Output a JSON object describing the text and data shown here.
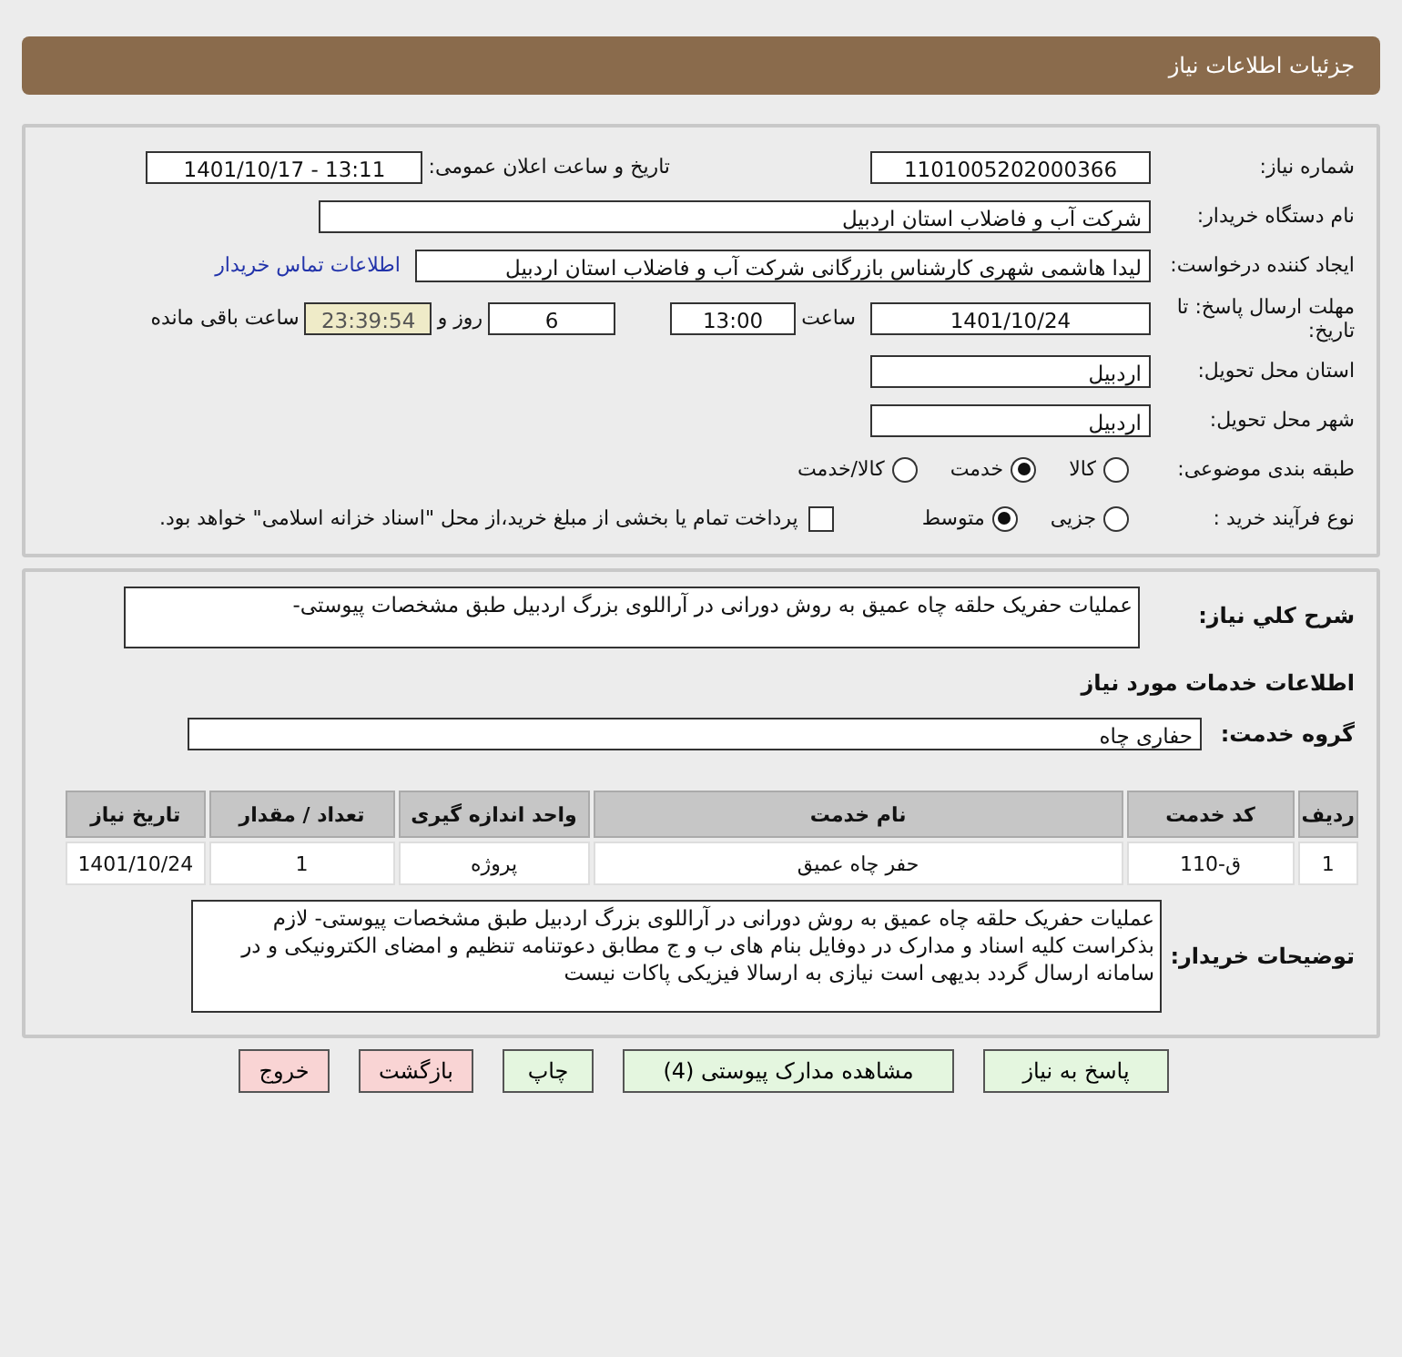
{
  "header": {
    "title": "جزئیات اطلاعات نیاز"
  },
  "need_number": {
    "label": "شماره نیاز:",
    "value": "1101005202000366"
  },
  "announce_datetime": {
    "label": "تاریخ و ساعت اعلان عمومی:",
    "value": "1401/10/17 - 13:11"
  },
  "buyer_org": {
    "label": "نام دستگاه خریدار:",
    "value": "شرکت آب و فاضلاب استان اردبیل"
  },
  "requester": {
    "label": "ایجاد کننده درخواست:",
    "value": "لیدا  هاشمی شهری کارشناس بازرگانی شرکت آب و فاضلاب استان اردبیل",
    "link": "اطلاعات تماس خریدار"
  },
  "deadline": {
    "label": "مهلت ارسال پاسخ: تا تاریخ:",
    "date": "1401/10/24",
    "time_label": "ساعت",
    "time": "13:00",
    "days": "6",
    "days_label": "روز و",
    "remaining": "23:39:54",
    "remaining_label": "ساعت باقی مانده"
  },
  "delivery_province": {
    "label": "استان محل تحویل:",
    "value": "اردبیل"
  },
  "delivery_city": {
    "label": "شهر محل تحویل:",
    "value": "اردبیل"
  },
  "category": {
    "label": "طبقه بندی موضوعی:",
    "options": [
      {
        "label": "کالا",
        "selected": false
      },
      {
        "label": "خدمت",
        "selected": true
      },
      {
        "label": "کالا/خدمت",
        "selected": false
      }
    ]
  },
  "purchase_type": {
    "label": "نوع فرآیند خرید :",
    "options": [
      {
        "label": "جزیی",
        "selected": false
      },
      {
        "label": "متوسط",
        "selected": true
      }
    ],
    "payment": {
      "label": "پرداخت تمام یا بخشی از مبلغ خرید،از محل \"اسناد خزانه اسلامی\" خواهد بود.",
      "checked": false
    }
  },
  "description": {
    "label": "شرح کلي نیاز:",
    "value": "عملیات حفریک حلقه چاه عمیق به روش دورانی در آراللوی بزرگ اردبیل طبق مشخصات پیوستی-"
  },
  "services_heading": "اطلاعات خدمات مورد نیاز",
  "service_group": {
    "label": "گروه خدمت:",
    "value": "حفاری چاه"
  },
  "table": {
    "columns": [
      "ردیف",
      "کد خدمت",
      "نام خدمت",
      "واحد اندازه گیری",
      "تعداد / مقدار",
      "تاریخ نیاز"
    ],
    "rows": [
      [
        "1",
        "ق-110",
        "حفر چاه عمیق",
        "پروژه",
        "1",
        "1401/10/24"
      ]
    ]
  },
  "buyer_notes": {
    "label": "توضیحات خریدار:",
    "value": "عملیات حفریک حلقه چاه عمیق به روش دورانی در آراللوی بزرگ اردبیل طبق مشخصات پیوستی- لازم بذکراست کلیه اسناد و مدارک در دوفایل بنام های ب و ج مطابق دعوتنامه تنظیم و امضای الکترونیکی و در سامانه ارسال گردد بدیهی است نیازی به ارسالا فیزیکی پاکات نیست"
  },
  "buttons": [
    {
      "label": "پاسخ به نیاز",
      "kind": "green"
    },
    {
      "label": "مشاهده مدارک پیوستی (4)",
      "kind": "green"
    },
    {
      "label": "چاپ",
      "kind": "green"
    },
    {
      "label": "بازگشت",
      "kind": "red"
    },
    {
      "label": "خروج",
      "kind": "red"
    }
  ]
}
